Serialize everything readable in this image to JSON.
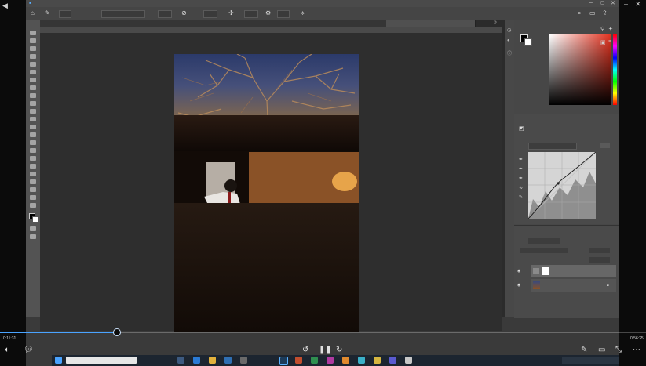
{
  "player": {
    "elapsed": "0:11:31",
    "duration": "0:56:25",
    "progress_fraction": 0.18
  },
  "app": {
    "menu_items": [
      "",
      "",
      "",
      "",
      "",
      "",
      "",
      "",
      "",
      "",
      ""
    ],
    "tabs": [
      {
        "label": "",
        "active": false
      },
      {
        "label": "",
        "active": false
      },
      {
        "label": "",
        "active": false
      },
      {
        "label": "",
        "active": false
      },
      {
        "label": "",
        "active": false
      },
      {
        "label": "",
        "active": false
      },
      {
        "label": "",
        "active": false
      },
      {
        "label": "",
        "active": true
      }
    ],
    "status_bar": ""
  },
  "panels": {
    "properties_preset": "",
    "layers": [
      {
        "name": "",
        "selected": true
      },
      {
        "name": "",
        "selected": false
      }
    ]
  },
  "colors": {
    "accent": "#4aa3ff",
    "photoshop_bg": "#2e2e2e",
    "foreground_swatch": "#000000",
    "background_swatch": "#ffffff"
  }
}
